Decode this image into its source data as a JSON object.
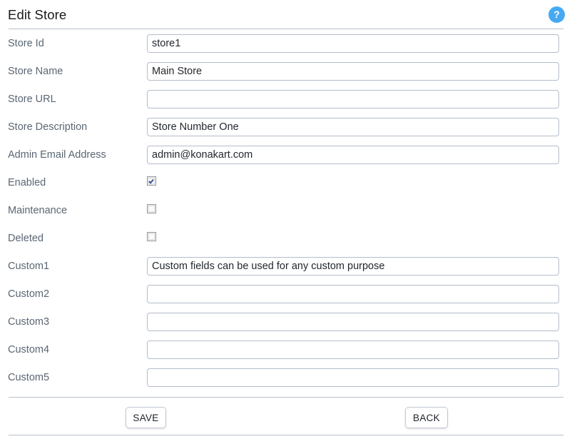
{
  "header": {
    "title": "Edit Store",
    "help_icon": "help-circle-icon",
    "help_glyph": "?"
  },
  "colors": {
    "accent": "#45aaf2",
    "label_text": "#5a6673",
    "divider": "#b7c0cd",
    "input_border": "#b4bdcb",
    "checkbox_check": "#36539b"
  },
  "form": {
    "fields": [
      {
        "label": "Store Id",
        "type": "text",
        "value": "store1",
        "placeholder": "",
        "name": "store-id"
      },
      {
        "label": "Store Name",
        "type": "text",
        "value": "Main Store",
        "placeholder": "",
        "name": "store-name"
      },
      {
        "label": "Store URL",
        "type": "text",
        "value": "",
        "placeholder": "",
        "name": "store-url"
      },
      {
        "label": "Store Description",
        "type": "text",
        "value": "Store Number One",
        "placeholder": "",
        "name": "store-description"
      },
      {
        "label": "Admin Email Address",
        "type": "text",
        "value": "admin@konakart.com",
        "placeholder": "",
        "name": "admin-email-address"
      },
      {
        "label": "Enabled",
        "type": "checkbox",
        "checked": true,
        "name": "enabled"
      },
      {
        "label": "Maintenance",
        "type": "checkbox",
        "checked": false,
        "name": "maintenance"
      },
      {
        "label": "Deleted",
        "type": "checkbox",
        "checked": false,
        "name": "deleted"
      },
      {
        "label": "Custom1",
        "type": "text",
        "value": "Custom fields can be used for any custom purpose",
        "placeholder": "",
        "name": "custom1"
      },
      {
        "label": "Custom2",
        "type": "text",
        "value": "",
        "placeholder": "",
        "name": "custom2"
      },
      {
        "label": "Custom3",
        "type": "text",
        "value": "",
        "placeholder": "",
        "name": "custom3"
      },
      {
        "label": "Custom4",
        "type": "text",
        "value": "",
        "placeholder": "",
        "name": "custom4"
      },
      {
        "label": "Custom5",
        "type": "text",
        "value": "",
        "placeholder": "",
        "name": "custom5"
      }
    ]
  },
  "footer": {
    "save_label": "SAVE",
    "back_label": "BACK"
  }
}
